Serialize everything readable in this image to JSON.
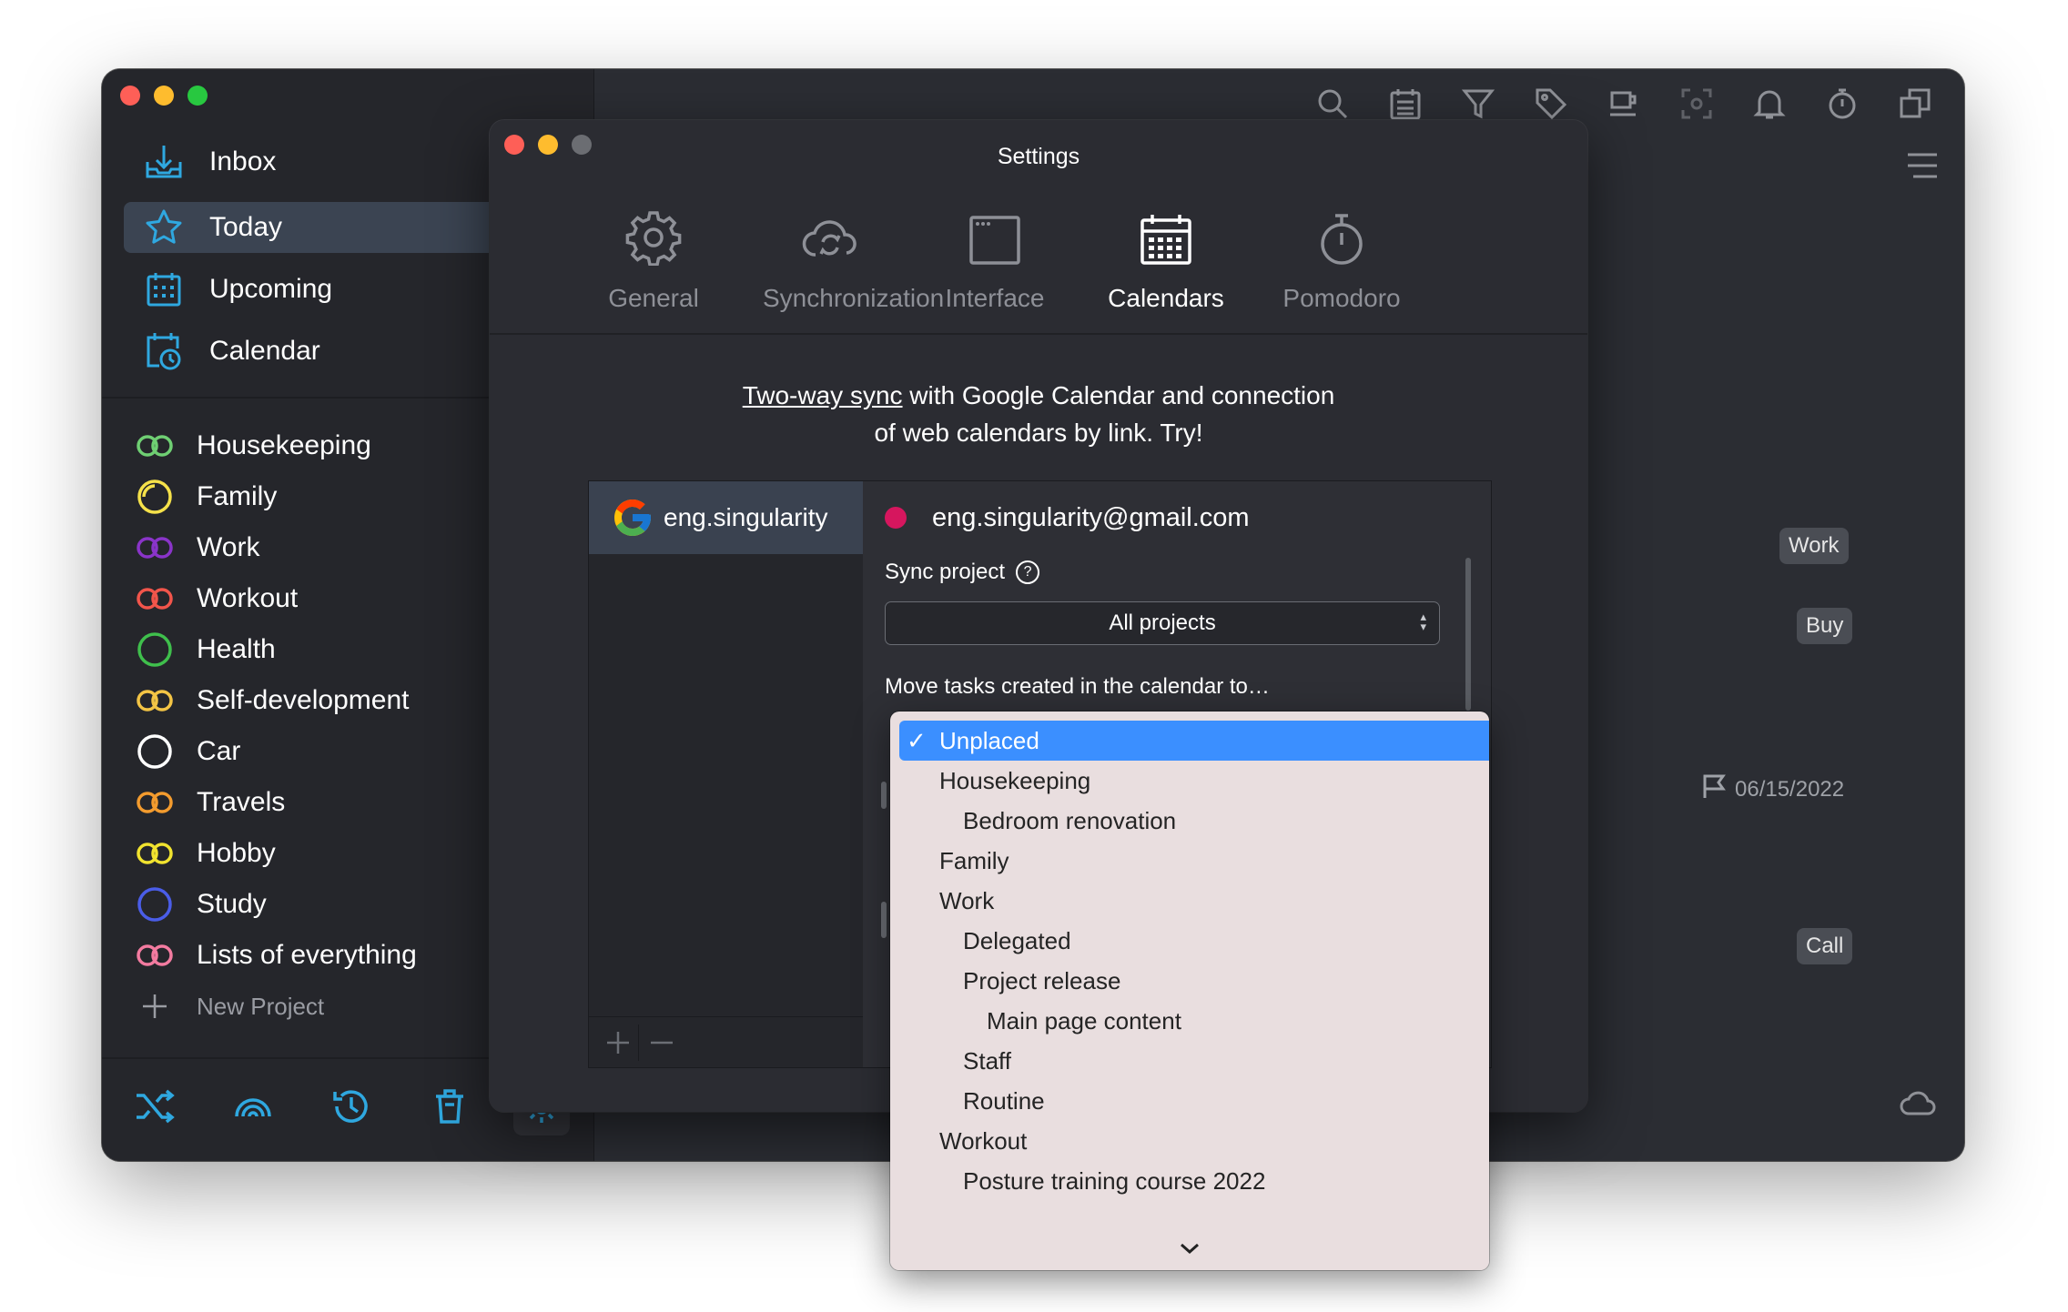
{
  "window": {
    "sidebar": {
      "nav": [
        {
          "label": "Inbox",
          "icon": "inbox-icon"
        },
        {
          "label": "Today",
          "icon": "star-icon"
        },
        {
          "label": "Upcoming",
          "icon": "calendar-grid-icon"
        },
        {
          "label": "Calendar",
          "icon": "calendar-clock-icon"
        }
      ],
      "projects": [
        {
          "label": "Housekeeping",
          "color": "#6fcf73",
          "icon": "linked-rings-icon"
        },
        {
          "label": "Family",
          "color": "#f5e14a",
          "icon": "progress-circle-icon"
        },
        {
          "label": "Work",
          "color": "#8a34c9",
          "icon": "linked-rings-icon"
        },
        {
          "label": "Workout",
          "color": "#f2554b",
          "icon": "linked-rings-icon"
        },
        {
          "label": "Health",
          "color": "#3fbf4c",
          "icon": "circle-icon"
        },
        {
          "label": "Self-development",
          "color": "#f3c445",
          "icon": "linked-rings-icon"
        },
        {
          "label": "Car",
          "color": "#ffffff",
          "icon": "circle-icon"
        },
        {
          "label": "Travels",
          "color": "#f39b2e",
          "icon": "linked-rings-icon"
        },
        {
          "label": "Hobby",
          "color": "#f1e32f",
          "icon": "linked-rings-icon"
        },
        {
          "label": "Study",
          "color": "#4a5de8",
          "icon": "circle-icon"
        },
        {
          "label": "Lists of everything",
          "color": "#f37ba0",
          "icon": "linked-rings-icon"
        }
      ],
      "new_project": "New Project"
    },
    "tags": {
      "work": "Work",
      "buy": "Buy",
      "call": "Call"
    },
    "due_date": "06/15/2022"
  },
  "settings": {
    "title": "Settings",
    "tabs": [
      {
        "label": "General",
        "icon": "gear-icon"
      },
      {
        "label": "Synchronization",
        "icon": "cloud-sync-icon"
      },
      {
        "label": "Interface",
        "icon": "window-icon"
      },
      {
        "label": "Calendars",
        "icon": "calendar-icon"
      },
      {
        "label": "Pomodoro",
        "icon": "stopwatch-icon"
      }
    ],
    "active_tab": "Calendars",
    "promo_link": "Two-way sync",
    "promo_text_1": " with Google Calendar and connection",
    "promo_text_2": "of web calendars by link. Try!",
    "account_name": "eng.singularity",
    "account_email": "eng.singularity@gmail.com",
    "account_color": "#d6165e",
    "sync_project_label": "Sync project",
    "sync_project_value": "All projects",
    "move_tasks_label": "Move tasks created in the calendar to…"
  },
  "dropdown": {
    "options": [
      {
        "label": "Unplaced",
        "selected": true
      },
      {
        "label": "Housekeeping"
      },
      {
        "label": "Bedroom renovation"
      },
      {
        "label": "Family"
      },
      {
        "label": "Work"
      },
      {
        "label": "Delegated"
      },
      {
        "label": "Project release"
      },
      {
        "label": "Main page content"
      },
      {
        "label": "Staff"
      },
      {
        "label": "Routine"
      },
      {
        "label": "Workout"
      },
      {
        "label": "Posture training course 2022"
      }
    ],
    "check_mark": "✓"
  }
}
